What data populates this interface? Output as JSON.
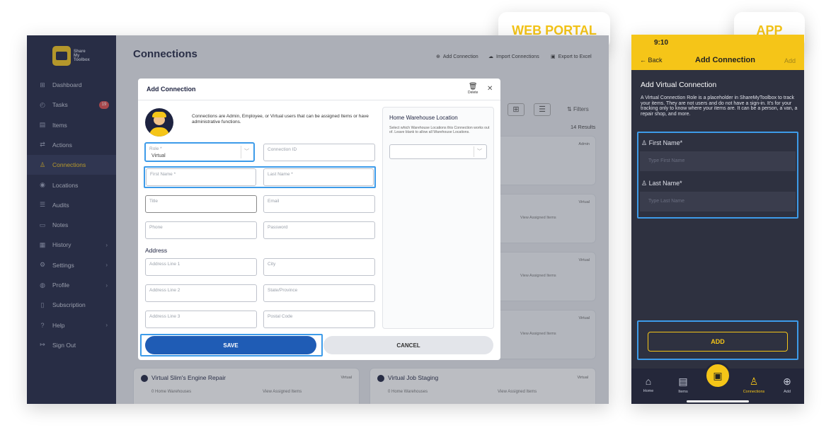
{
  "tags": {
    "web": "WEB PORTAL",
    "app": "APP"
  },
  "web": {
    "logo": "Share My Toolbox",
    "sidebar": [
      {
        "icon": "dashboard-icon",
        "glyph": "⊞",
        "label": "Dashboard"
      },
      {
        "icon": "tasks-icon",
        "glyph": "◴",
        "label": "Tasks",
        "badge": "19"
      },
      {
        "icon": "items-icon",
        "glyph": "▤",
        "label": "Items"
      },
      {
        "icon": "actions-icon",
        "glyph": "⇄",
        "label": "Actions"
      },
      {
        "icon": "connections-icon",
        "glyph": "♙",
        "label": "Connections"
      },
      {
        "icon": "locations-icon",
        "glyph": "◉",
        "label": "Locations"
      },
      {
        "icon": "audits-icon",
        "glyph": "☰",
        "label": "Audits"
      },
      {
        "icon": "notes-icon",
        "glyph": "▭",
        "label": "Notes"
      },
      {
        "icon": "history-icon",
        "glyph": "▦",
        "label": "History",
        "chev": true
      },
      {
        "icon": "settings-icon",
        "glyph": "⚙",
        "label": "Settings",
        "chev": true
      },
      {
        "icon": "profile-icon",
        "glyph": "◍",
        "label": "Profile",
        "chev": true
      },
      {
        "icon": "subscription-icon",
        "glyph": "▯",
        "label": "Subscription"
      },
      {
        "icon": "help-icon",
        "glyph": "?",
        "label": "Help",
        "chev": true
      },
      {
        "icon": "signout-icon",
        "glyph": "↦",
        "label": "Sign Out"
      }
    ],
    "title": "Connections",
    "toolbar": {
      "add": "Add Connection",
      "import": "Import Connections",
      "export": "Export to Excel"
    },
    "filters": "Filters",
    "results": "14 Results",
    "bg": {
      "admin": "Admin",
      "virtual": "Virtual",
      "view": "View Assigned Items",
      "home": "0 Home Warehouses",
      "card1": "Virtual Slim's Engine Repair",
      "card2": "Virtual Job Staging"
    },
    "modal": {
      "title": "Add Connection",
      "delete": "Delete",
      "intro": "Connections are Admin, Employee, or Virtual users that can be assigned Items or have administrative functions.",
      "role_label": "Role *",
      "role_value": "Virtual",
      "connid": "Connection ID",
      "first": "First Name *",
      "last": "Last Name *",
      "title_f": "Title",
      "email": "Email",
      "phone": "Phone",
      "password": "Password",
      "address": "Address",
      "addr1": "Address Line 1",
      "city": "City",
      "addr2": "Address Line 2",
      "state": "State/Province",
      "addr3": "Address Line 3",
      "postal": "Postal Code",
      "wh_title": "Home Warehouse Location",
      "wh_desc": "Select which Warehouse Locations this Connection works out of. Leave blank to allow all Warehouse Locations.",
      "save": "SAVE",
      "cancel": "CANCEL"
    }
  },
  "app": {
    "time": "9:10",
    "back": "Back",
    "title": "Add Connection",
    "add": "Add",
    "heading": "Add Virtual Connection",
    "desc": "A Virtual Connection Role is a placeholder in ShareMyToolbox to track your items. They are not users and do not have a sign-in. It's for your tracking only to know where your items are. It can be a person, a van, a repair shop, and more.",
    "first_label": "First Name*",
    "first_ph": "Type First Name",
    "last_label": "Last Name*",
    "last_ph": "Type Last Name",
    "add_btn": "ADD",
    "nav": [
      {
        "icon": "home-icon",
        "glyph": "⌂",
        "label": "Home"
      },
      {
        "icon": "items-icon",
        "glyph": "▤",
        "label": "Items"
      },
      {
        "icon": "connections-icon",
        "glyph": "♙",
        "label": "Connections"
      },
      {
        "icon": "add-icon",
        "glyph": "⊕",
        "label": "Add"
      }
    ]
  },
  "colors": {
    "accent": "#f5c518",
    "navy": "#1e2340",
    "highlight": "#3d9be9",
    "save": "#1f5cb5"
  }
}
